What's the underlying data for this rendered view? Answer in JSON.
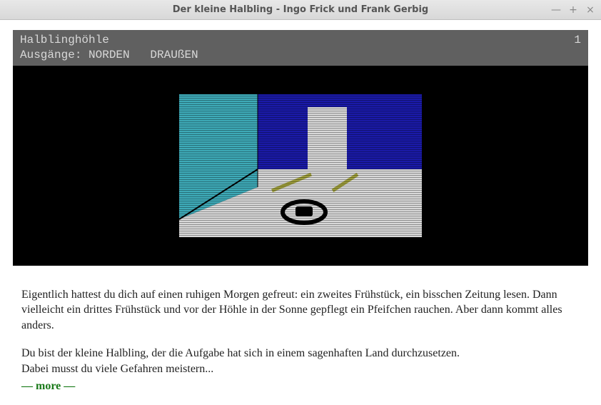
{
  "window": {
    "title": "Der kleine Halbling - Ingo Frick und Frank Gerbig"
  },
  "statusbar": {
    "location": "Halblinghöhle",
    "score": "1",
    "exits_label": "Ausgänge: NORDEN   DRAUßEN"
  },
  "story": {
    "para1": "Eigentlich hattest du dich auf einen ruhigen Morgen gefreut: ein zweites Frühstück, ein bisschen Zeitung lesen. Dann vielleicht ein drittes Frühstück und vor der Höhle in der Sonne gepflegt ein Pfeifchen rauchen. Aber dann kommt alles anders.",
    "para2": "Du bist der kleine Halbling, der die Aufgabe hat sich in einem sagenhaften Land durchzusetzen.\nDabei musst du viele Gefahren meistern...",
    "more": "— more —"
  },
  "icons": {
    "minimize": "—",
    "maximize": "+",
    "close": "×"
  },
  "illustration": {
    "caption": "Halblinghöhle scene",
    "colors": {
      "sky_left": "#3eaab8",
      "night": "#1a1aa8",
      "wall": "#d8d8d8",
      "floor": "#d8d8d8",
      "stripe": "#9c9c3a"
    }
  }
}
